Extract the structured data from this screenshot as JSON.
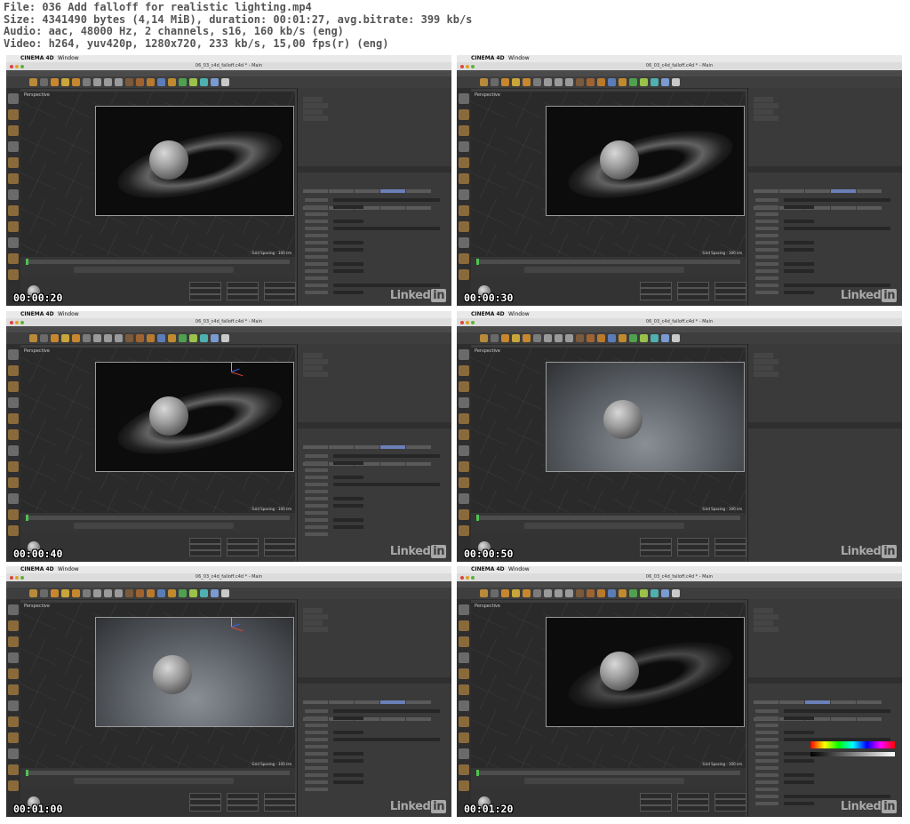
{
  "header": {
    "file_line": "File: 036 Add falloff for realistic lighting.mp4",
    "size_line": "Size: 4341490 bytes (4,14 MiB), duration: 00:01:27, avg.bitrate: 399 kb/s",
    "audio_line": "Audio: aac, 48000 Hz, 2 channels, s16, 160 kb/s (eng)",
    "video_line": "Video: h264, yuv420p, 1280x720, 233 kb/s, 15,00 fps(r) (eng)"
  },
  "app": {
    "apple": "",
    "name": "CINEMA 4D",
    "menu_window": "Window",
    "doc_title": "06_03_c4d_falloff.c4d * - Main",
    "grid_spacing": "Grid Spacing : 100 cm",
    "perspective": "Perspective",
    "watermark_text": "Linked",
    "watermark_in": "in"
  },
  "thumbs": [
    {
      "timestamp": "00:00:20",
      "scene": "dark-ring",
      "attr": "details"
    },
    {
      "timestamp": "00:00:30",
      "scene": "dark-ring",
      "attr": "details"
    },
    {
      "timestamp": "00:00:40",
      "scene": "dark-ring-gizmo",
      "attr": "details-short"
    },
    {
      "timestamp": "00:00:50",
      "scene": "lit-floor",
      "attr": "empty"
    },
    {
      "timestamp": "00:01:00",
      "scene": "lit-floor-gizmo",
      "attr": "details-short"
    },
    {
      "timestamp": "00:01:20",
      "scene": "dark-ring-dim",
      "attr": "general-color"
    }
  ],
  "colors": {
    "ui_dark": "#3d3d3d",
    "accent_tab": "#6b7fb8",
    "play_green": "#4fc24f",
    "axis_y": "#5fd15f",
    "axis_x": "#e04444",
    "axis_z": "#4466ee"
  }
}
